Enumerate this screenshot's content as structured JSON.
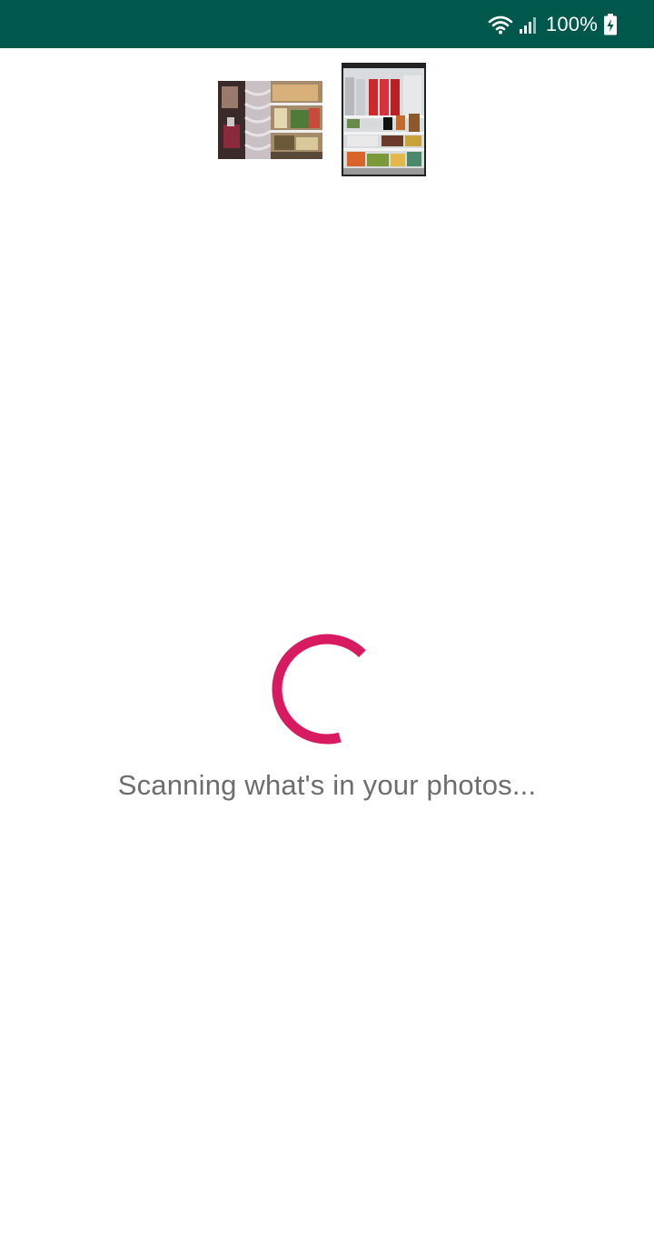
{
  "status_bar": {
    "battery_percent": "100%",
    "background_color": "#00574b",
    "icons": [
      "wifi-icon",
      "signal-icon",
      "battery-charging-icon"
    ]
  },
  "photos": {
    "count": 2,
    "items": [
      {
        "name": "fridge-photo-1"
      },
      {
        "name": "fridge-photo-2"
      }
    ]
  },
  "loading": {
    "message": "Scanning what's in your photos...",
    "spinner_color": "#d81b60"
  }
}
